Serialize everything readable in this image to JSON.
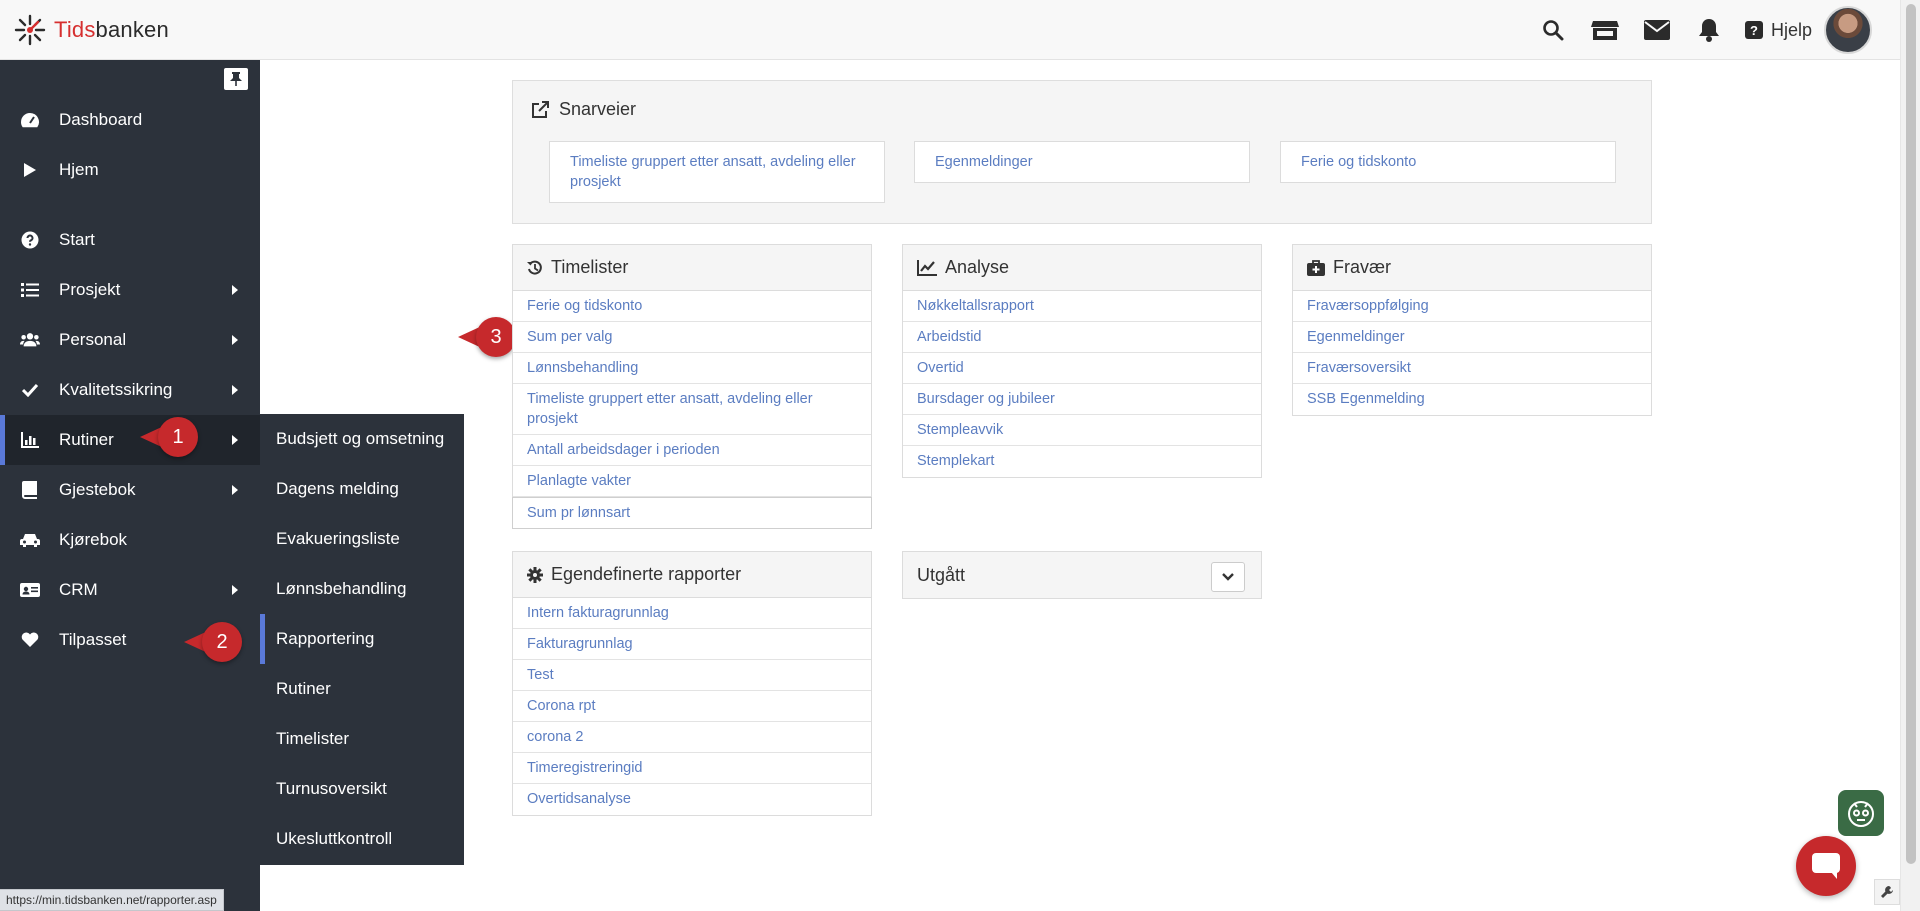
{
  "header": {
    "logo_prefix": "Tids",
    "logo_suffix": "banken",
    "help_label": "Hjelp",
    "help_glyph": "?"
  },
  "sidebar": {
    "items": [
      {
        "label": "Dashboard",
        "icon": "tachometer-icon"
      },
      {
        "label": "Hjem",
        "icon": "play-icon"
      },
      {
        "label": "Start",
        "icon": "question-circle-icon"
      },
      {
        "label": "Prosjekt",
        "icon": "list-icon"
      },
      {
        "label": "Personal",
        "icon": "users-icon"
      },
      {
        "label": "Kvalitetssikring",
        "icon": "check-icon"
      },
      {
        "label": "Rutiner",
        "icon": "bar-chart-icon"
      },
      {
        "label": "Gjestebok",
        "icon": "book-icon"
      },
      {
        "label": "Kjørebok",
        "icon": "car-icon"
      },
      {
        "label": "CRM",
        "icon": "id-card-icon"
      },
      {
        "label": "Tilpasset",
        "icon": "heart-icon"
      }
    ],
    "active_item": "Rutiner"
  },
  "submenu": {
    "items": [
      "Budsjett og omsetning",
      "Dagens melding",
      "Evakueringsliste",
      "Lønnsbehandling",
      "Rapportering",
      "Rutiner",
      "Timelister",
      "Turnusoversikt",
      "Ukesluttkontroll"
    ],
    "active_item": "Rapportering"
  },
  "callouts": [
    "1",
    "2",
    "3"
  ],
  "shortcuts": {
    "title": "Snarveier",
    "items": [
      "Timeliste gruppert etter ansatt, avdeling eller prosjekt",
      "Egenmeldinger",
      "Ferie og tidskonto"
    ]
  },
  "cards": {
    "timelister": {
      "title": "Timelister",
      "items": [
        "Ferie og tidskonto",
        "Sum per valg",
        "Lønnsbehandling",
        "Timeliste gruppert etter ansatt, avdeling eller prosjekt",
        "Antall arbeidsdager i perioden",
        "Planlagte vakter",
        "Sum pr lønnsart"
      ]
    },
    "analyse": {
      "title": "Analyse",
      "items": [
        "Nøkkeltallsrapport",
        "Arbeidstid",
        "Overtid",
        "Bursdager og jubileer",
        "Stempleavvik",
        "Stemplekart"
      ]
    },
    "fravaer": {
      "title": "Fravær",
      "items": [
        "Fraværsoppfølging",
        "Egenmeldinger",
        "Fraværsoversikt",
        "SSB Egenmelding"
      ]
    },
    "egendefinerte": {
      "title": "Egendefinerte rapporter",
      "items": [
        "Intern fakturagrunnlag",
        "Fakturagrunnlag",
        "Test",
        "Corona rpt",
        "corona 2",
        "Timeregistreringid",
        "Overtidsanalyse"
      ]
    },
    "utgatt": {
      "title": "Utgått"
    }
  },
  "status_url": "https://min.tidsbanken.net/rapporter.asp",
  "colors": {
    "sidebar_bg": "#2c323b",
    "accent": "#5a79d8",
    "link": "#5b7dc1",
    "callout": "#c6292c",
    "brand_red": "#d62f2f"
  }
}
